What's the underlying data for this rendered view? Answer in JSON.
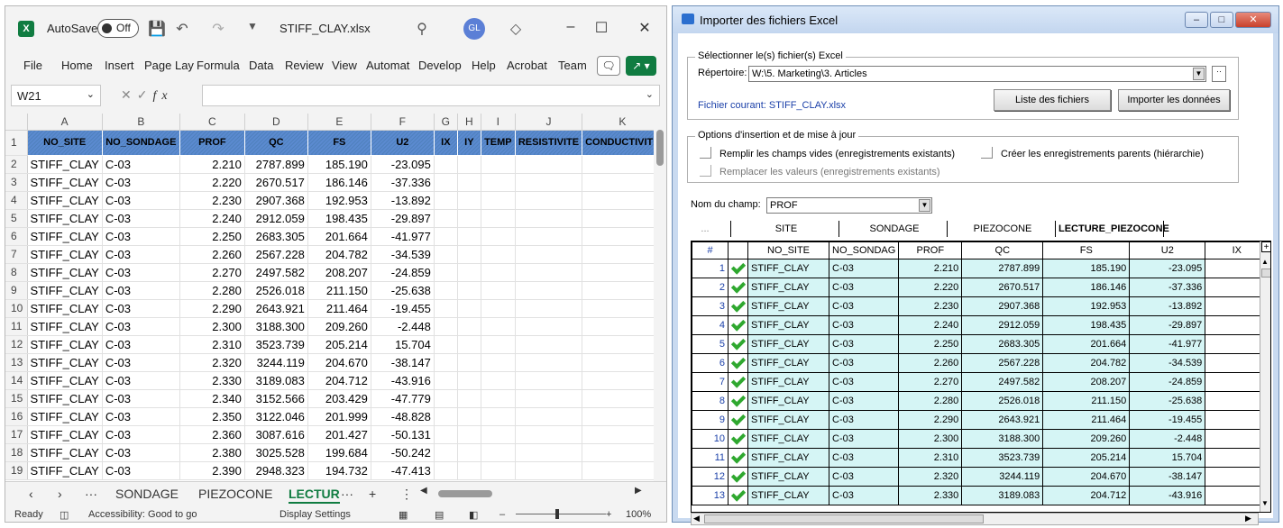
{
  "excel": {
    "autosave_label": "AutoSave",
    "autosave_state": "Off",
    "filename": "STIFF_CLAY.xlsx",
    "avatar": "GL",
    "ribbon_tabs": [
      "File",
      "Home",
      "Insert",
      "Page Lay",
      "Formula",
      "Data",
      "Review",
      "View",
      "Automat",
      "Develop",
      "Help",
      "Acrobat",
      "Team"
    ],
    "name_box": "W21",
    "col_letters": [
      "A",
      "B",
      "C",
      "D",
      "E",
      "F",
      "G",
      "H",
      "I",
      "J",
      "K"
    ],
    "headers": [
      "NO_SITE",
      "NO_SONDAGE",
      "PROF",
      "QC",
      "FS",
      "U2",
      "IX",
      "IY",
      "TEMP",
      "RESISTIVITE",
      "CONDUCTIVITE"
    ],
    "rows": [
      [
        "2",
        "STIFF_CLAY",
        "C-03",
        "2.210",
        "2787.899",
        "185.190",
        "-23.095"
      ],
      [
        "3",
        "STIFF_CLAY",
        "C-03",
        "2.220",
        "2670.517",
        "186.146",
        "-37.336"
      ],
      [
        "4",
        "STIFF_CLAY",
        "C-03",
        "2.230",
        "2907.368",
        "192.953",
        "-13.892"
      ],
      [
        "5",
        "STIFF_CLAY",
        "C-03",
        "2.240",
        "2912.059",
        "198.435",
        "-29.897"
      ],
      [
        "6",
        "STIFF_CLAY",
        "C-03",
        "2.250",
        "2683.305",
        "201.664",
        "-41.977"
      ],
      [
        "7",
        "STIFF_CLAY",
        "C-03",
        "2.260",
        "2567.228",
        "204.782",
        "-34.539"
      ],
      [
        "8",
        "STIFF_CLAY",
        "C-03",
        "2.270",
        "2497.582",
        "208.207",
        "-24.859"
      ],
      [
        "9",
        "STIFF_CLAY",
        "C-03",
        "2.280",
        "2526.018",
        "211.150",
        "-25.638"
      ],
      [
        "10",
        "STIFF_CLAY",
        "C-03",
        "2.290",
        "2643.921",
        "211.464",
        "-19.455"
      ],
      [
        "11",
        "STIFF_CLAY",
        "C-03",
        "2.300",
        "3188.300",
        "209.260",
        "-2.448"
      ],
      [
        "12",
        "STIFF_CLAY",
        "C-03",
        "2.310",
        "3523.739",
        "205.214",
        "15.704"
      ],
      [
        "13",
        "STIFF_CLAY",
        "C-03",
        "2.320",
        "3244.119",
        "204.670",
        "-38.147"
      ],
      [
        "14",
        "STIFF_CLAY",
        "C-03",
        "2.330",
        "3189.083",
        "204.712",
        "-43.916"
      ],
      [
        "15",
        "STIFF_CLAY",
        "C-03",
        "2.340",
        "3152.566",
        "203.429",
        "-47.779"
      ],
      [
        "16",
        "STIFF_CLAY",
        "C-03",
        "2.350",
        "3122.046",
        "201.999",
        "-48.828"
      ],
      [
        "17",
        "STIFF_CLAY",
        "C-03",
        "2.360",
        "3087.616",
        "201.427",
        "-50.131"
      ],
      [
        "18",
        "STIFF_CLAY",
        "C-03",
        "2.380",
        "3025.528",
        "199.684",
        "-50.242"
      ],
      [
        "19",
        "STIFF_CLAY",
        "C-03",
        "2.390",
        "2948.323",
        "194.732",
        "-47.413"
      ]
    ],
    "sheet_tabs": [
      "SONDAGE",
      "PIEZOCONE",
      "LECTUR"
    ],
    "status_ready": "Ready",
    "status_accessibility": "Accessibility: Good to go",
    "status_display": "Display Settings",
    "zoom": "100%"
  },
  "dialog": {
    "title": "Importer des fichiers Excel",
    "group1_legend": "Sélectionner le(s) fichier(s) Excel",
    "repertoire_label": "Répertoire:",
    "repertoire_value": "W:\\5. Marketing\\3. Articles",
    "current_file_label": "Fichier courant: STIFF_CLAY.xlsx",
    "btn_list": "Liste des fichiers",
    "btn_import": "Importer les données",
    "group2_legend": "Options d'insertion et de mise à jour",
    "opt_fill": "Remplir les champs vides (enregistrements existants)",
    "opt_create": "Créer les enregistrements parents (hiérarchie)",
    "opt_replace": "Remplacer les valeurs (enregistrements existants)",
    "field_label": "Nom du champ:",
    "field_value": "PROF",
    "tabs": [
      "...",
      "SITE",
      "SONDAGE",
      "PIEZOCONE",
      "LECTURE_PIEZOCONE"
    ],
    "grid_headers": [
      "#",
      "",
      "NO_SITE",
      "NO_SONDAG",
      "PROF",
      "QC",
      "FS",
      "U2",
      "IX"
    ],
    "grid_rows": [
      [
        "1",
        "STIFF_CLAY",
        "C-03",
        "2.210",
        "2787.899",
        "185.190",
        "-23.095"
      ],
      [
        "2",
        "STIFF_CLAY",
        "C-03",
        "2.220",
        "2670.517",
        "186.146",
        "-37.336"
      ],
      [
        "3",
        "STIFF_CLAY",
        "C-03",
        "2.230",
        "2907.368",
        "192.953",
        "-13.892"
      ],
      [
        "4",
        "STIFF_CLAY",
        "C-03",
        "2.240",
        "2912.059",
        "198.435",
        "-29.897"
      ],
      [
        "5",
        "STIFF_CLAY",
        "C-03",
        "2.250",
        "2683.305",
        "201.664",
        "-41.977"
      ],
      [
        "6",
        "STIFF_CLAY",
        "C-03",
        "2.260",
        "2567.228",
        "204.782",
        "-34.539"
      ],
      [
        "7",
        "STIFF_CLAY",
        "C-03",
        "2.270",
        "2497.582",
        "208.207",
        "-24.859"
      ],
      [
        "8",
        "STIFF_CLAY",
        "C-03",
        "2.280",
        "2526.018",
        "211.150",
        "-25.638"
      ],
      [
        "9",
        "STIFF_CLAY",
        "C-03",
        "2.290",
        "2643.921",
        "211.464",
        "-19.455"
      ],
      [
        "10",
        "STIFF_CLAY",
        "C-03",
        "2.300",
        "3188.300",
        "209.260",
        "-2.448"
      ],
      [
        "11",
        "STIFF_CLAY",
        "C-03",
        "2.310",
        "3523.739",
        "205.214",
        "15.704"
      ],
      [
        "12",
        "STIFF_CLAY",
        "C-03",
        "2.320",
        "3244.119",
        "204.670",
        "-38.147"
      ],
      [
        "13",
        "STIFF_CLAY",
        "C-03",
        "2.330",
        "3189.083",
        "204.712",
        "-43.916"
      ]
    ]
  }
}
